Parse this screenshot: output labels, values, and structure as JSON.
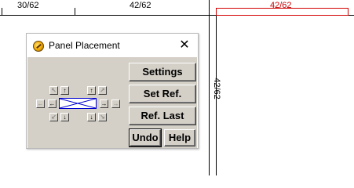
{
  "drawing": {
    "dim_left": "30/62",
    "dim_mid": "42/62",
    "dim_selected": "42/62",
    "dim_vertical": "42/62",
    "selected_color": "#d40000"
  },
  "dialog": {
    "title": "Panel Placement",
    "close_glyph": "✕",
    "app_icon": "globe-icon",
    "buttons": {
      "settings": "Settings",
      "set_ref": "Set Ref.",
      "ref_last": "Ref. Last",
      "undo": "Undo",
      "help": "Help"
    },
    "nudge": {
      "up": "↑",
      "down": "↓",
      "left": "←",
      "right": "→",
      "corner_up_left": "↖",
      "corner_up_right": "↗",
      "corner_down_left": "↙",
      "corner_down_right": "↘"
    }
  }
}
